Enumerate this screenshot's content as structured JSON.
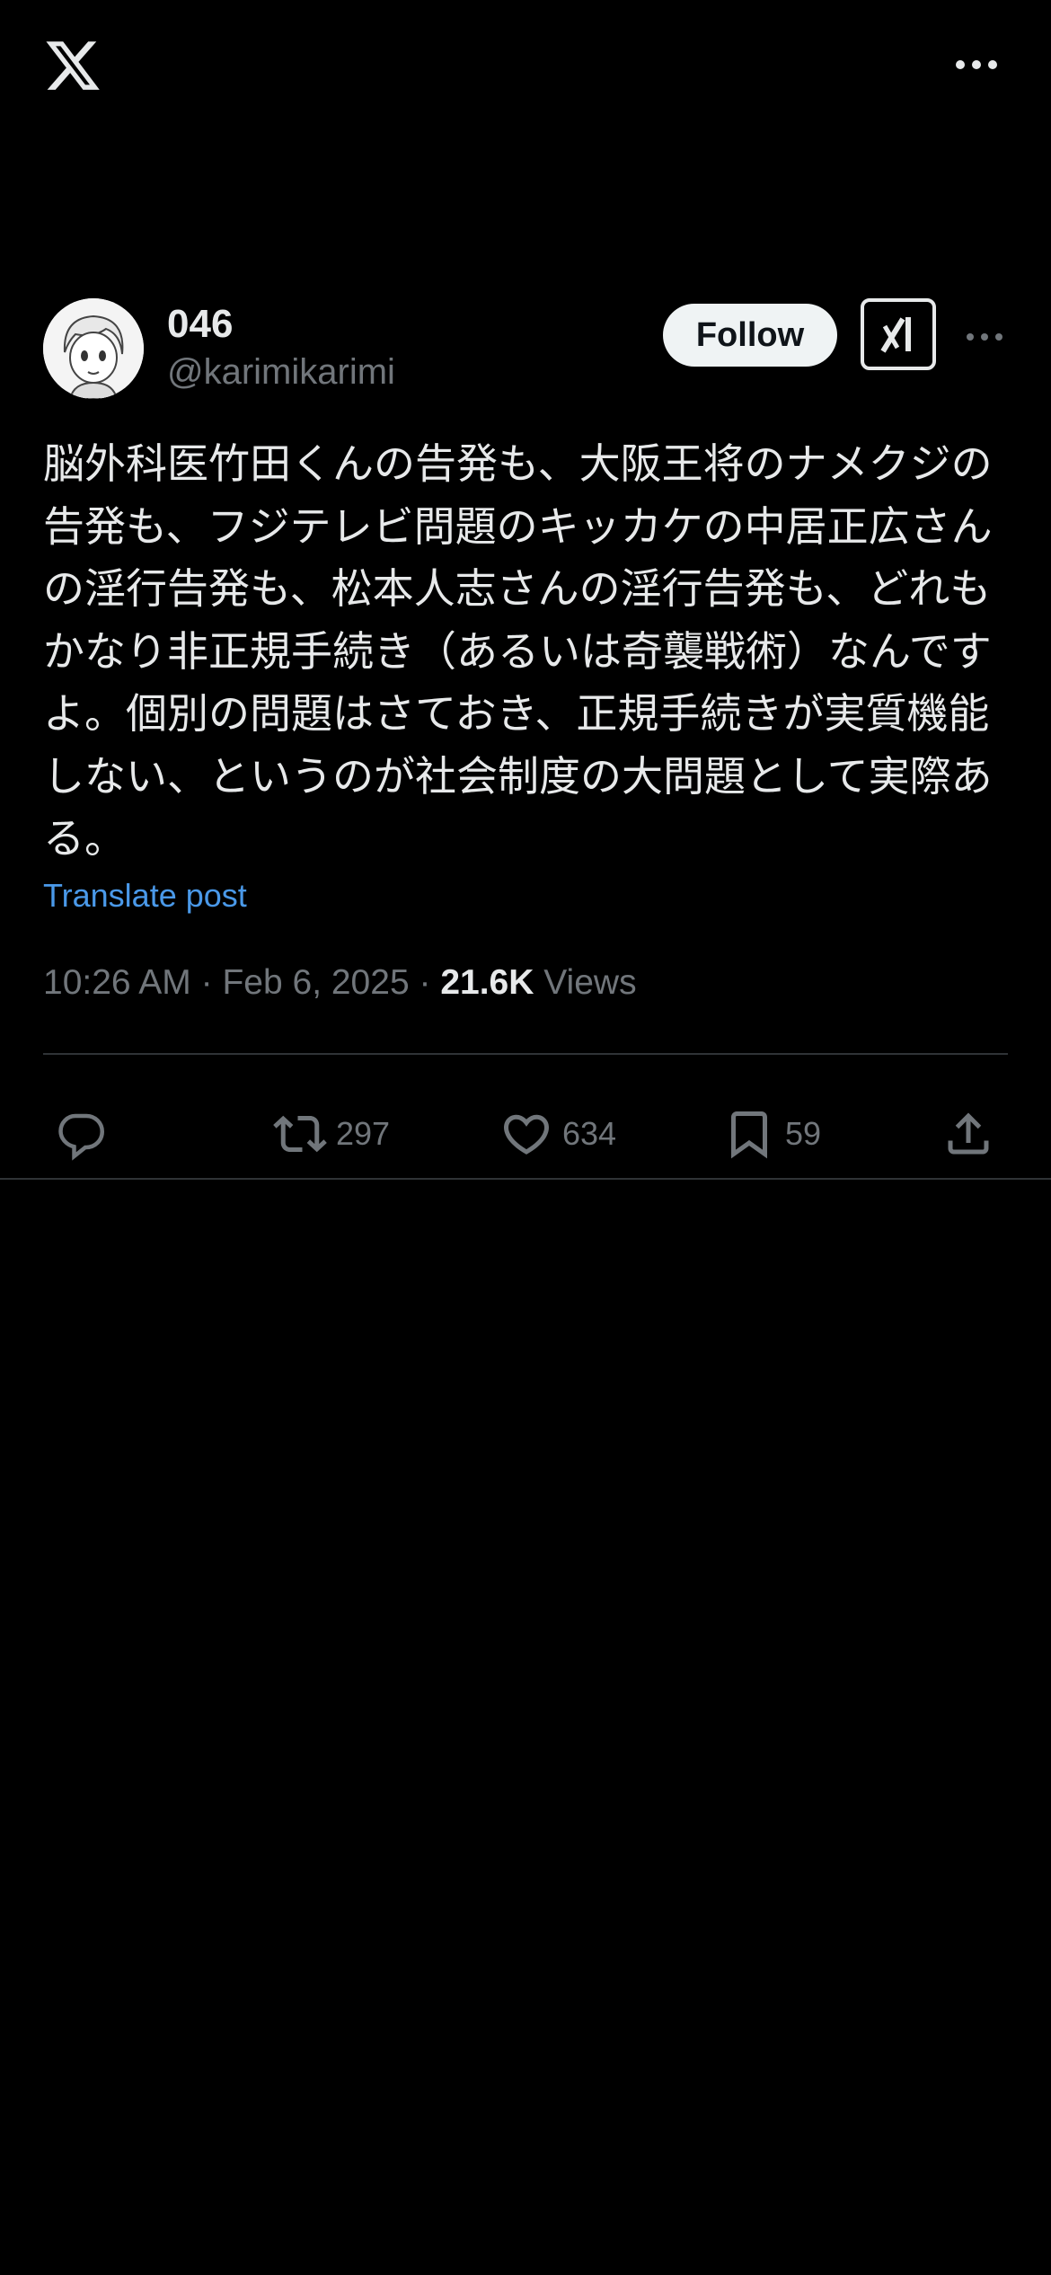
{
  "topbar": {
    "logo_icon": "x-logo-icon",
    "more_icon": "more-horizontal-icon"
  },
  "author": {
    "name": "046",
    "handle": "@karimikarimi",
    "follow_label": "Follow",
    "grok_icon": "grok-icon",
    "more_icon": "more-horizontal-icon"
  },
  "tweet": {
    "text": "脳外科医竹田くんの告発も、大阪王将のナメクジの告発も、フジテレビ問題のキッカケの中居正広さんの淫行告発も、松本人志さんの淫行告発も、どれもかなり非正規手続き（あるいは奇襲戦術）なんですよ。個別の問題はさておき、正規手続きが実質機能しない、というのが社会制度の大問題として実際ある。",
    "translate_label": "Translate post",
    "time": "10:26 AM",
    "date": "Feb 6, 2025",
    "separator": "·",
    "views_count": "21.6K",
    "views_label": "Views"
  },
  "actions": {
    "reply_icon": "reply-icon",
    "retweet_icon": "retweet-icon",
    "retweet_count": "297",
    "like_icon": "heart-icon",
    "like_count": "634",
    "bookmark_icon": "bookmark-icon",
    "bookmark_count": "59",
    "share_icon": "share-icon"
  },
  "colors": {
    "background": "#000000",
    "text": "#e7e9ea",
    "secondary": "#71767b",
    "link": "#4a99e9"
  }
}
